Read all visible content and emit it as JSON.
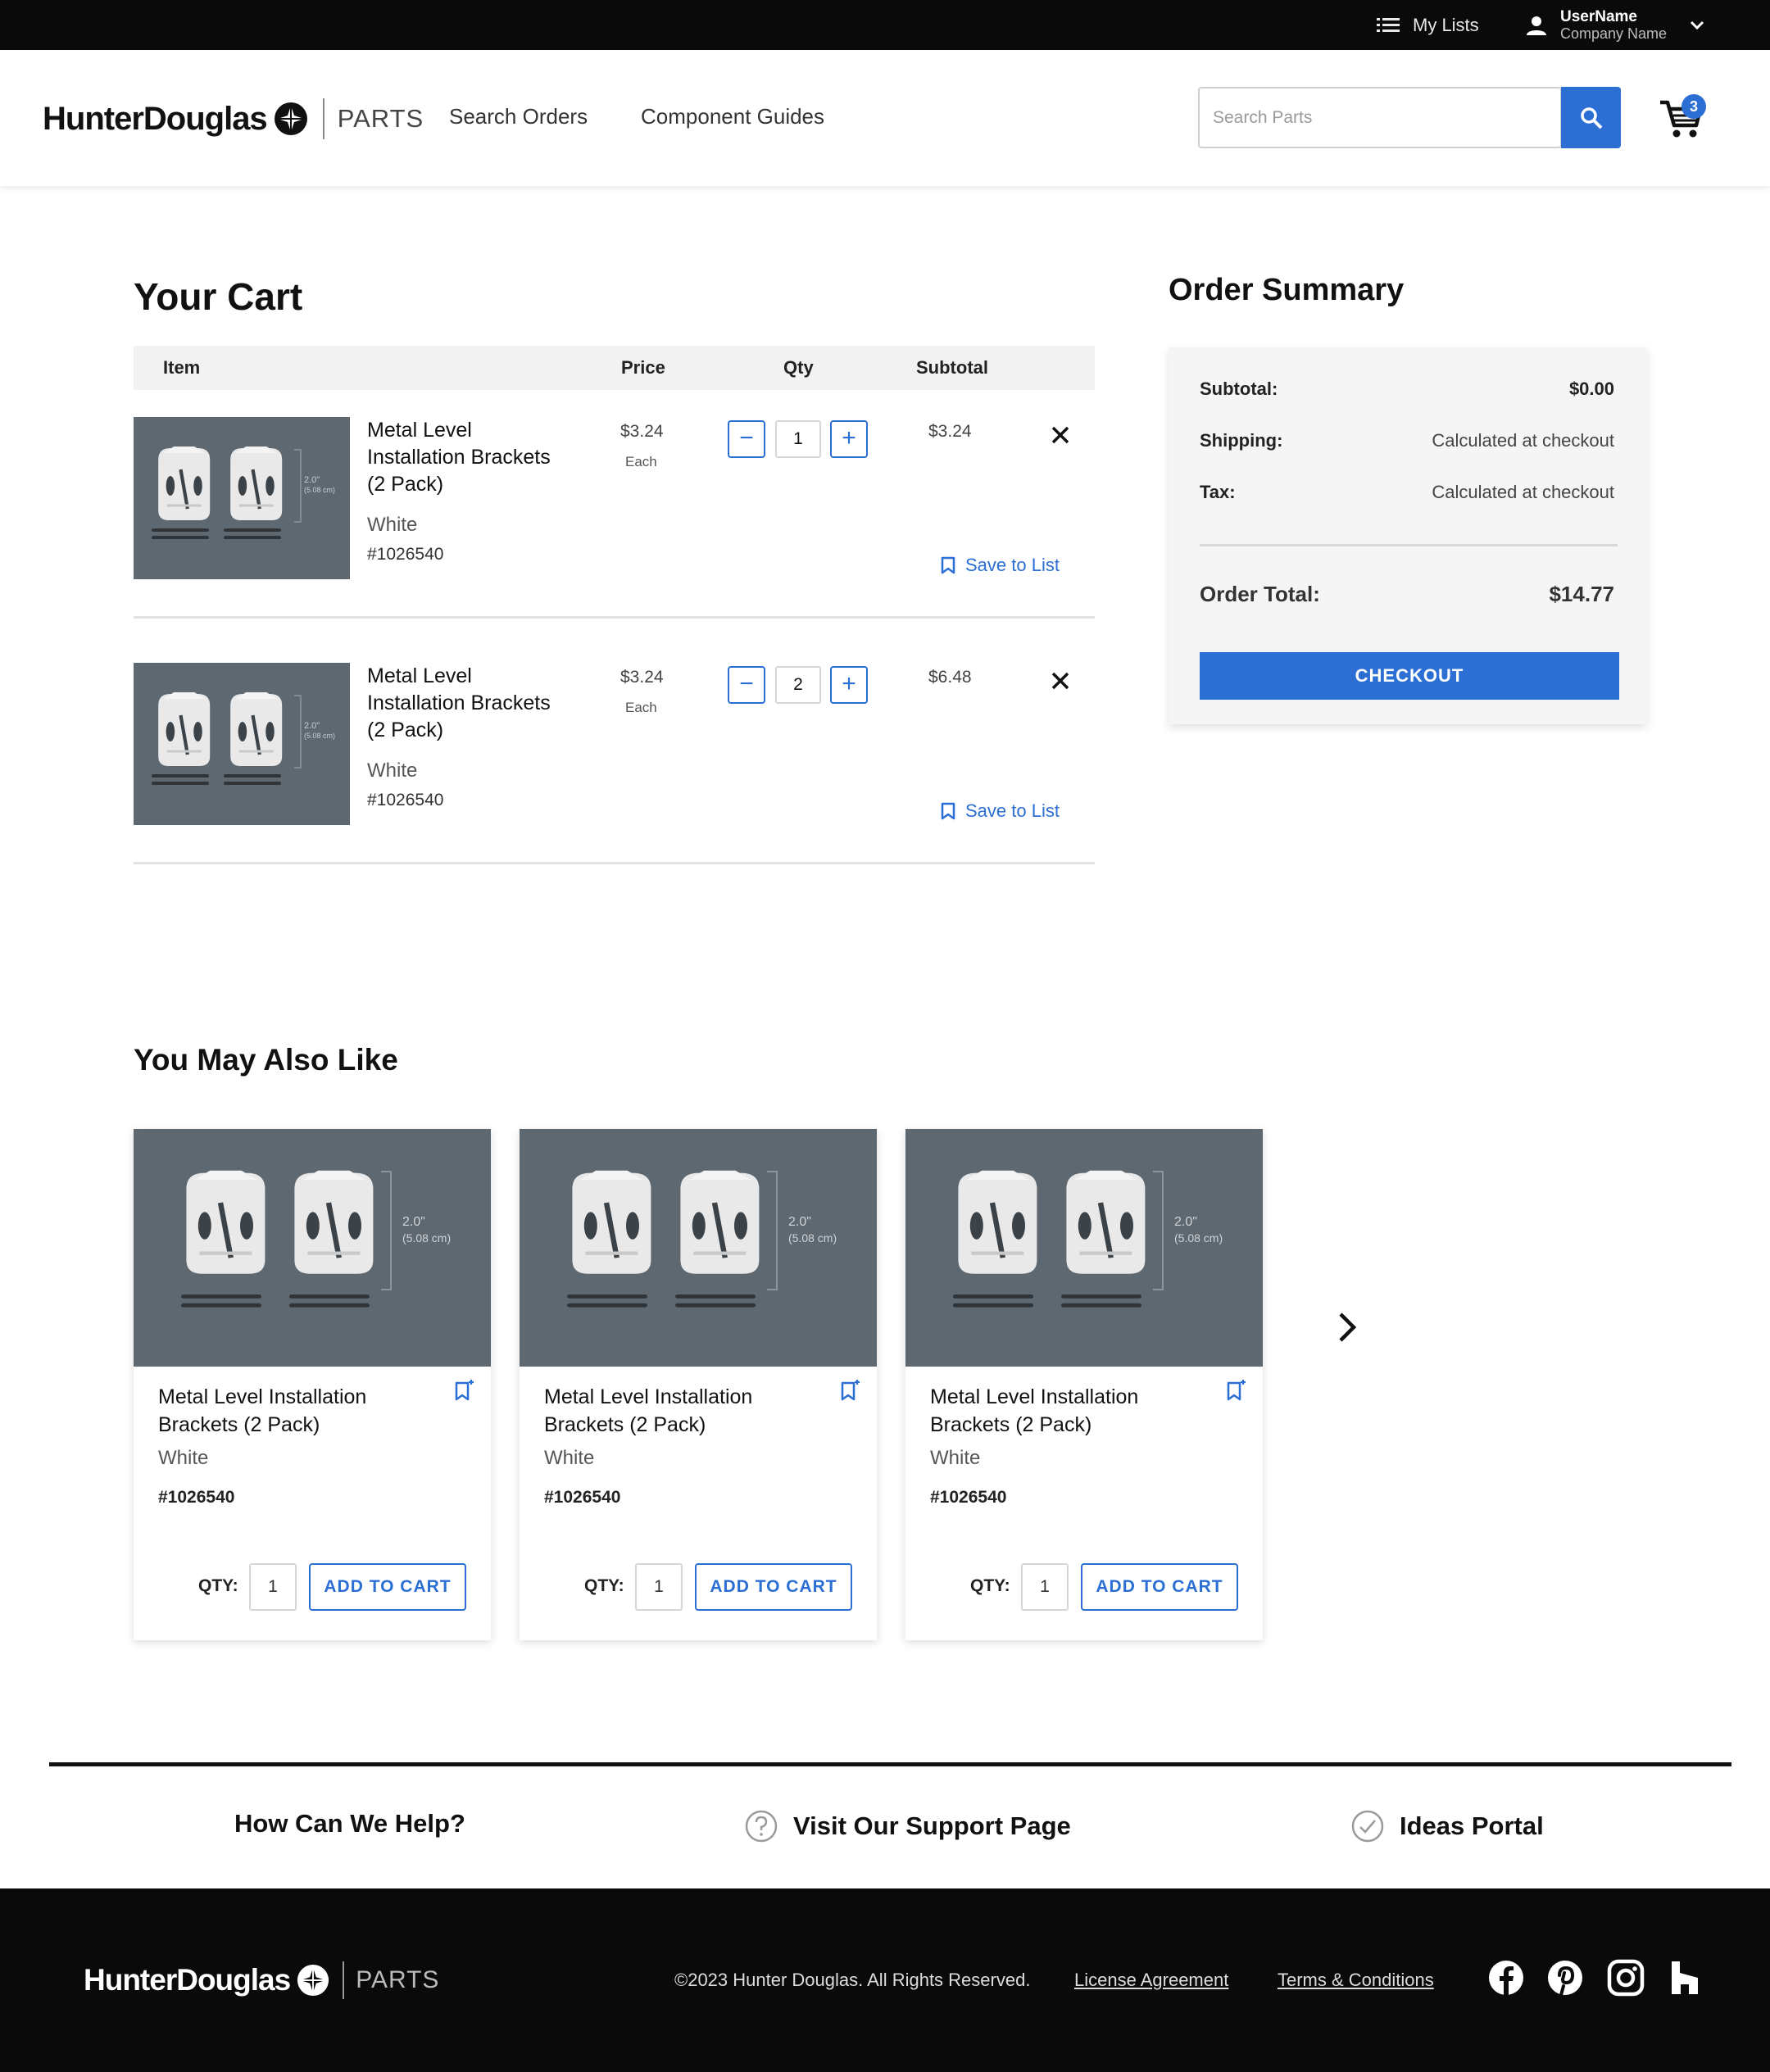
{
  "topbar": {
    "my_lists": "My Lists",
    "username": "UserName",
    "company": "Company Name"
  },
  "header": {
    "brand": "HunterDouglas",
    "parts": "PARTS",
    "nav": [
      "Search Orders",
      "Component Guides"
    ],
    "search_placeholder": "Search Parts",
    "cart_count": "3"
  },
  "cart": {
    "title": "Your Cart",
    "columns": {
      "item": "Item",
      "price": "Price",
      "qty": "Qty",
      "subtotal": "Subtotal"
    },
    "items": [
      {
        "title": "Metal Level Installation Brackets (2 Pack)",
        "color": "White",
        "sku": "#1026540",
        "price": "$3.24",
        "unit": "Each",
        "qty": "1",
        "subtotal": "$3.24",
        "save_label": "Save to List"
      },
      {
        "title": "Metal Level Installation Brackets (2 Pack)",
        "color": "White",
        "sku": "#1026540",
        "price": "$3.24",
        "unit": "Each",
        "qty": "2",
        "subtotal": "$6.48",
        "save_label": "Save to List"
      }
    ]
  },
  "summary": {
    "title": "Order Summary",
    "subtotal_label": "Subtotal:",
    "subtotal_value": "$0.00",
    "shipping_label": "Shipping:",
    "shipping_value": "Calculated at checkout",
    "tax_label": "Tax:",
    "tax_value": "Calculated at checkout",
    "total_label": "Order Total:",
    "total_value": "$14.77",
    "checkout_label": "CHECKOUT"
  },
  "also_like": {
    "title": "You May Also Like",
    "dimension_label": "2.0\"",
    "dimension_metric": "(5.08 cm)",
    "qty_label": "QTY:",
    "add_label": "ADD TO CART",
    "cards": [
      {
        "title": "Metal Level Installation Brackets (2 Pack)",
        "color": "White",
        "sku": "#1026540",
        "qty": "1"
      },
      {
        "title": "Metal Level Installation Brackets (2 Pack)",
        "color": "White",
        "sku": "#1026540",
        "qty": "1"
      },
      {
        "title": "Metal Level Installation Brackets (2 Pack)",
        "color": "White",
        "sku": "#1026540",
        "qty": "1"
      }
    ]
  },
  "help": {
    "title": "How Can We Help?",
    "support": "Visit Our Support Page",
    "ideas": "Ideas Portal"
  },
  "footer": {
    "copyright": "©2023 Hunter Douglas. All Rights Reserved.",
    "license": "License Agreement",
    "terms": "Terms & Conditions",
    "social": [
      "facebook-icon",
      "pinterest-icon",
      "instagram-icon",
      "houzz-icon"
    ]
  },
  "colors": {
    "accent": "#2b6ed4",
    "product_bg": "#5e6870",
    "bar": "#0a0a0a"
  }
}
